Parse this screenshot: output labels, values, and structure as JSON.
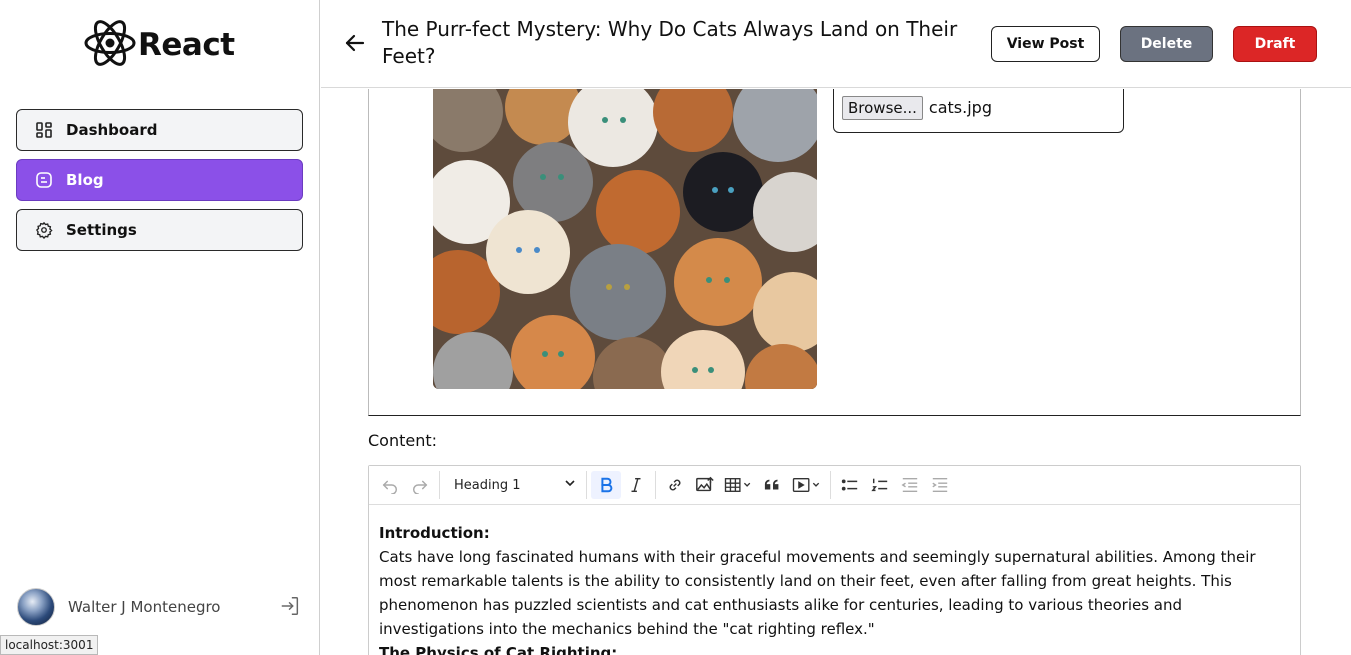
{
  "brand": {
    "name": "React",
    "icon": "react-atom-icon"
  },
  "sidebar": {
    "items": [
      {
        "label": "Dashboard",
        "icon": "dashboard-grid-icon",
        "active": false
      },
      {
        "label": "Blog",
        "icon": "blog-document-icon",
        "active": true
      },
      {
        "label": "Settings",
        "icon": "gear-icon",
        "active": false
      }
    ],
    "user": {
      "name": "Walter J Montenegro",
      "logout_icon": "logout-icon"
    }
  },
  "status_bar": {
    "url": "localhost:3001"
  },
  "header": {
    "back_icon": "arrow-left-icon",
    "title": "The Purr-fect Mystery: Why Do Cats Always Land on Their Feet?",
    "buttons": {
      "view": "View Post",
      "delete": "Delete",
      "draft": "Draft"
    }
  },
  "image_upload": {
    "browse_label": "Browse...",
    "file_name": "cats.jpg"
  },
  "content": {
    "label": "Content:",
    "toolbar": {
      "heading_select": "Heading 1",
      "icons": [
        "undo-icon",
        "redo-icon",
        "bold-icon",
        "italic-icon",
        "link-icon",
        "insert-image-icon",
        "table-icon",
        "blockquote-icon",
        "media-embed-icon",
        "bulleted-list-icon",
        "numbered-list-icon",
        "outdent-icon",
        "indent-icon"
      ]
    },
    "body": {
      "intro_heading": "Introduction:",
      "intro_text": "Cats have long fascinated humans with their graceful movements and seemingly supernatural abilities. Among their most remarkable talents is the ability to consistently land on their feet, even after falling from great heights. This phenomenon has puzzled scientists and cat enthusiasts alike for centuries, leading to various theories and investigations into the mechanics behind the \"cat righting reflex.\"",
      "section_heading": "The Physics of Cat Righting:"
    }
  },
  "colors": {
    "accent": "#8b50e8",
    "delete": "#6b7280",
    "draft": "#dc2626",
    "bold_active": "#1a73e8"
  }
}
